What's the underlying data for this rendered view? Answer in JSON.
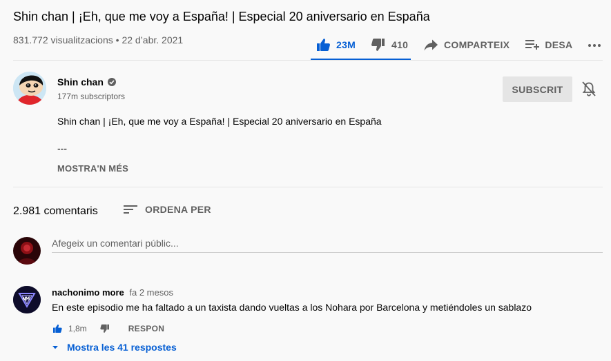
{
  "video": {
    "title": "Shin chan | ¡Eh, que me voy a España! | Especial 20 aniversario en España",
    "meta": "831.772 visualitzacions • 22 d’abr. 2021"
  },
  "actions": {
    "likes": "23M",
    "dislikes": "410",
    "share_label": "COMPARTEIX",
    "save_label": "DESA",
    "accent_color": "#065fd4"
  },
  "channel": {
    "name": "Shin chan",
    "subscribers": "177m subscriptors",
    "subscribe_label": "SUBSCRIT",
    "description_line1": "Shin chan | ¡Eh, que me voy a España! | Especial 20 aniversario en España",
    "description_line2": "---",
    "show_more_label": "MOSTRA'N MÉS"
  },
  "comments": {
    "count": "2.981 comentaris",
    "sort_label": "ORDENA PER",
    "add_placeholder": "Afegeix un comentari públic...",
    "items": [
      {
        "author": "nachonimo more",
        "time": "fa 2 mesos",
        "text": "En este episodio me ha faltado a un taxista dando vueltas a los Nohara por Barcelona y metiéndoles un sablazo",
        "likes": "1,8m",
        "reply_label": "RESPON",
        "replies_label": "Mostra les 41 respostes"
      }
    ]
  }
}
